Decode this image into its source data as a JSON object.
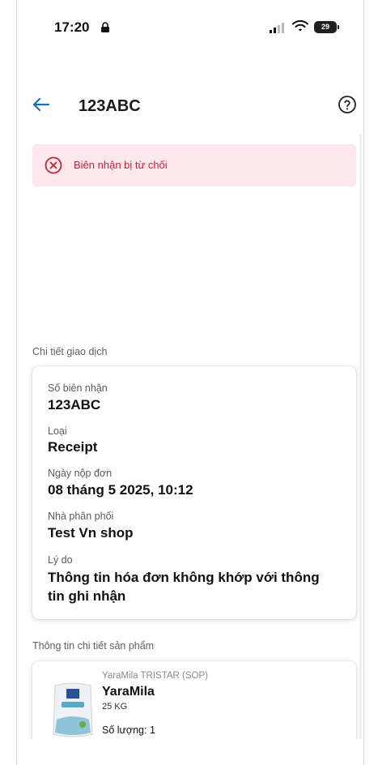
{
  "status_bar": {
    "time": "17:20",
    "battery": "29"
  },
  "app_bar": {
    "title": "123ABC"
  },
  "alert": {
    "text": "Biên nhận bị từ chối",
    "color": "#c0243a"
  },
  "transaction": {
    "section_title": "Chi tiết giao dịch",
    "receipt_no_label": "Số biên nhận",
    "receipt_no_value": "123ABC",
    "type_label": "Loại",
    "type_value": "Receipt",
    "date_label": "Ngày nộp đơn",
    "date_value": "08 tháng 5 2025, 10:12",
    "distributor_label": "Nhà phân phối",
    "distributor_value": "Test Vn shop",
    "reason_label": "Lý do",
    "reason_value": "Thông tin hóa đơn không khớp với thông tin ghi nhận"
  },
  "product": {
    "section_title": "Thông tin chi tiết sản phẩm",
    "line": "YaraMila TRISTAR (SOP)",
    "name": "YaraMila",
    "size": "25 KG",
    "quantity": "Số lượng: 1"
  },
  "colors": {
    "accent": "#1f6fb2",
    "alert_bg": "#fce8ec"
  }
}
